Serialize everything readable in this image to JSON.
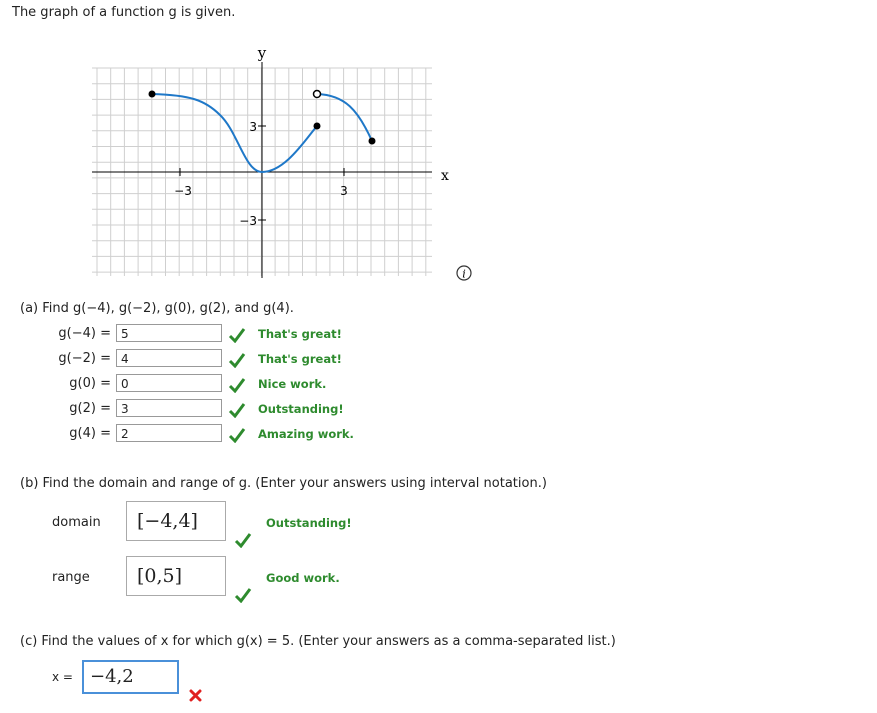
{
  "intro": "The graph of a function g is given.",
  "graph": {
    "y_label": "y",
    "x_label": "x",
    "ticks": {
      "x_neg": "−3",
      "x_pos": "3",
      "y_pos": "3",
      "y_neg": "−3"
    },
    "info_icon": "i"
  },
  "part_a": {
    "prompt": "(a)  Find g(−4), g(−2), g(0), g(2), and g(4).",
    "rows": [
      {
        "label": "g(−4)  =",
        "value": "5",
        "feedback": "That's great!"
      },
      {
        "label": "g(−2)  =",
        "value": "4",
        "feedback": "That's great!"
      },
      {
        "label": "g(0)  =",
        "value": "0",
        "feedback": "Nice work."
      },
      {
        "label": "g(2)  =",
        "value": "3",
        "feedback": "Outstanding!"
      },
      {
        "label": "g(4)  =",
        "value": "2",
        "feedback": "Amazing work."
      }
    ]
  },
  "part_b": {
    "prompt": "(b)  Find the domain and range of g. (Enter your answers using interval notation.)",
    "domain_label": "domain",
    "domain_value": "[−4,4]",
    "domain_feedback": "Outstanding!",
    "range_label": "range",
    "range_value": "[0,5]",
    "range_feedback": "Good work."
  },
  "part_c": {
    "prompt": "(c)  Find the values of x for which g(x) = 5. (Enter your answers as a comma-separated list.)",
    "x_label": "x =",
    "x_value": "−4,2"
  },
  "colors": {
    "curve": "#1f78c8",
    "correct": "#2e8b2e",
    "wrong": "#e02020"
  }
}
